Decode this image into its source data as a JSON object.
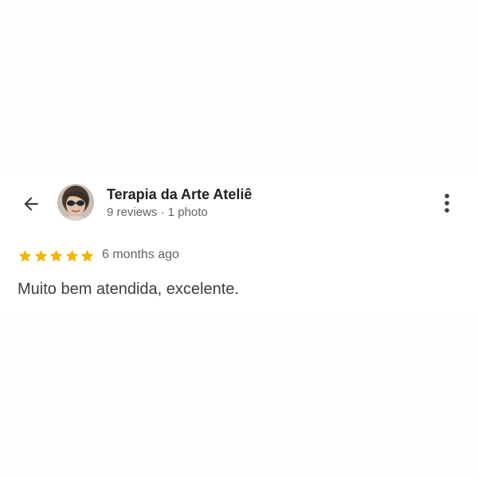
{
  "header": {
    "reviewer_name": "Terapia da Arte Ateliê",
    "reviewer_meta": "9 reviews · 1 photo",
    "back_icon": "arrow-back-icon",
    "more_icon": "more-vert-icon"
  },
  "review": {
    "rating": 5,
    "rating_max": 5,
    "time_ago": "6 months ago",
    "text": "Muito bem atendida, excelente."
  },
  "colors": {
    "star": "#f4b400",
    "primary_text": "#202124",
    "secondary_text": "#5f6368"
  }
}
